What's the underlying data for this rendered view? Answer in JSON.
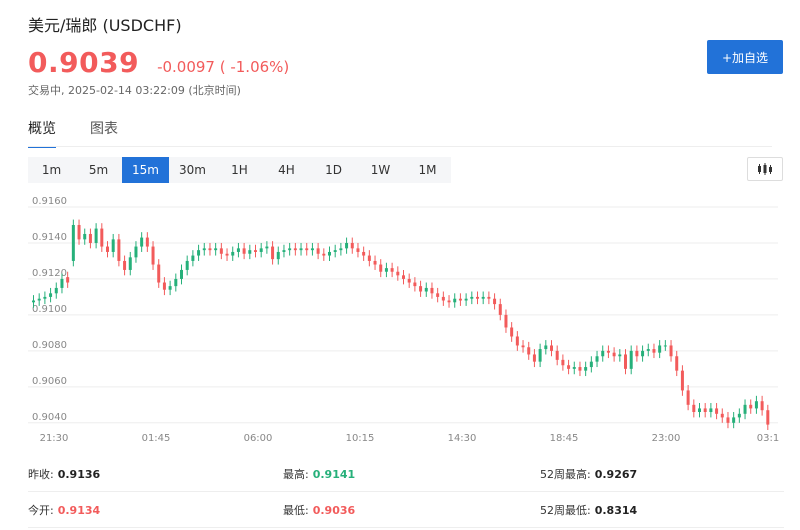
{
  "header": {
    "title": "美元/瑞郎 (USDCHF)",
    "price": "0.9039",
    "change": "-0.0097 ( -1.06%)",
    "status": "交易中, 2025-02-14 03:22:09 (北京时间)",
    "add_label": "+加自选"
  },
  "tabs": [
    {
      "label": "概览",
      "active": true
    },
    {
      "label": "图表",
      "active": false
    }
  ],
  "periods": [
    {
      "label": "1m",
      "active": false
    },
    {
      "label": "5m",
      "active": false
    },
    {
      "label": "15m",
      "active": true
    },
    {
      "label": "30m",
      "active": false
    },
    {
      "label": "1H",
      "active": false
    },
    {
      "label": "4H",
      "active": false
    },
    {
      "label": "1D",
      "active": false
    },
    {
      "label": "1W",
      "active": false
    },
    {
      "label": "1M",
      "active": false
    }
  ],
  "chart_data": {
    "type": "candlestick",
    "y_ticks": [
      "0.9160",
      "0.9140",
      "0.9120",
      "0.9100",
      "0.9080",
      "0.9060",
      "0.9040"
    ],
    "ylim": [
      0.9036,
      0.9165
    ],
    "x_ticks": [
      "21:30",
      "01:45",
      "06:00",
      "10:15",
      "14:30",
      "18:45",
      "23:00",
      "03:1"
    ],
    "colors": {
      "up": "#26b07a",
      "down": "#f25b5b"
    },
    "closes": [
      0.9108,
      0.9109,
      0.911,
      0.9112,
      0.9115,
      0.912,
      0.9118,
      0.915,
      0.9142,
      0.9145,
      0.914,
      0.9148,
      0.9138,
      0.9135,
      0.9142,
      0.913,
      0.9125,
      0.9132,
      0.9138,
      0.9143,
      0.9138,
      0.9128,
      0.9118,
      0.9114,
      0.9116,
      0.912,
      0.9125,
      0.913,
      0.9133,
      0.9136,
      0.9137,
      0.9136,
      0.9137,
      0.9134,
      0.9133,
      0.9135,
      0.9137,
      0.9134,
      0.9136,
      0.9135,
      0.9137,
      0.9138,
      0.9131,
      0.9135,
      0.9136,
      0.9137,
      0.9136,
      0.9137,
      0.9136,
      0.9137,
      0.9134,
      0.9133,
      0.9135,
      0.9136,
      0.9137,
      0.914,
      0.9137,
      0.9135,
      0.9133,
      0.913,
      0.9128,
      0.9124,
      0.9126,
      0.9124,
      0.9122,
      0.912,
      0.9118,
      0.9116,
      0.9113,
      0.9115,
      0.9112,
      0.911,
      0.9108,
      0.9107,
      0.9109,
      0.9108,
      0.9109,
      0.911,
      0.9109,
      0.911,
      0.9109,
      0.9106,
      0.91,
      0.9093,
      0.9088,
      0.9083,
      0.9082,
      0.9078,
      0.9074,
      0.9081,
      0.9083,
      0.908,
      0.9075,
      0.9072,
      0.907,
      0.9071,
      0.9069,
      0.9071,
      0.9074,
      0.9077,
      0.908,
      0.9079,
      0.9077,
      0.9078,
      0.907,
      0.908,
      0.9077,
      0.908,
      0.9081,
      0.9079,
      0.9083,
      0.9083,
      0.9077,
      0.9069,
      0.9058,
      0.905,
      0.9046,
      0.9048,
      0.9046,
      0.9048,
      0.9045,
      0.9043,
      0.904,
      0.9043,
      0.9045,
      0.905,
      0.9048,
      0.9052,
      0.9047,
      0.9039
    ],
    "opens": [
      0.9107,
      0.9108,
      0.9109,
      0.911,
      0.9112,
      0.9115,
      0.9121,
      0.913,
      0.915,
      0.9142,
      0.9145,
      0.914,
      0.9148,
      0.9138,
      0.9135,
      0.9142,
      0.913,
      0.9125,
      0.9132,
      0.9138,
      0.9143,
      0.9138,
      0.9128,
      0.9118,
      0.9114,
      0.9116,
      0.912,
      0.9125,
      0.913,
      0.9133,
      0.9136,
      0.9137,
      0.9136,
      0.9137,
      0.9134,
      0.9133,
      0.9135,
      0.9137,
      0.9134,
      0.9136,
      0.9135,
      0.9137,
      0.9138,
      0.9131,
      0.9135,
      0.9136,
      0.9137,
      0.9136,
      0.9137,
      0.9136,
      0.9137,
      0.9134,
      0.9133,
      0.9135,
      0.9136,
      0.9137,
      0.914,
      0.9137,
      0.9135,
      0.9133,
      0.913,
      0.9128,
      0.9124,
      0.9126,
      0.9124,
      0.9122,
      0.912,
      0.9118,
      0.9116,
      0.9113,
      0.9115,
      0.9112,
      0.911,
      0.9108,
      0.9107,
      0.9109,
      0.9108,
      0.9109,
      0.911,
      0.9109,
      0.911,
      0.9109,
      0.9106,
      0.91,
      0.9093,
      0.9088,
      0.9083,
      0.9082,
      0.9078,
      0.9074,
      0.9081,
      0.9083,
      0.908,
      0.9075,
      0.9072,
      0.907,
      0.9071,
      0.9069,
      0.9071,
      0.9074,
      0.9077,
      0.908,
      0.9079,
      0.9077,
      0.9078,
      0.907,
      0.908,
      0.9077,
      0.908,
      0.9081,
      0.9079,
      0.9083,
      0.9083,
      0.9077,
      0.9069,
      0.9058,
      0.905,
      0.9046,
      0.9048,
      0.9046,
      0.9048,
      0.9045,
      0.9043,
      0.904,
      0.9043,
      0.9045,
      0.905,
      0.9048,
      0.9052,
      0.9047
    ]
  },
  "stats": {
    "row1": [
      {
        "label": "昨收:",
        "value": "0.9136",
        "color": "dark"
      },
      {
        "label": "最高:",
        "value": "0.9141",
        "color": "green"
      },
      {
        "label": "52周最高:",
        "value": "0.9267",
        "color": "dark"
      }
    ],
    "row2": [
      {
        "label": "今开:",
        "value": "0.9134",
        "color": "red"
      },
      {
        "label": "最低:",
        "value": "0.9036",
        "color": "red"
      },
      {
        "label": "52周最低:",
        "value": "0.8314",
        "color": "dark"
      }
    ]
  }
}
